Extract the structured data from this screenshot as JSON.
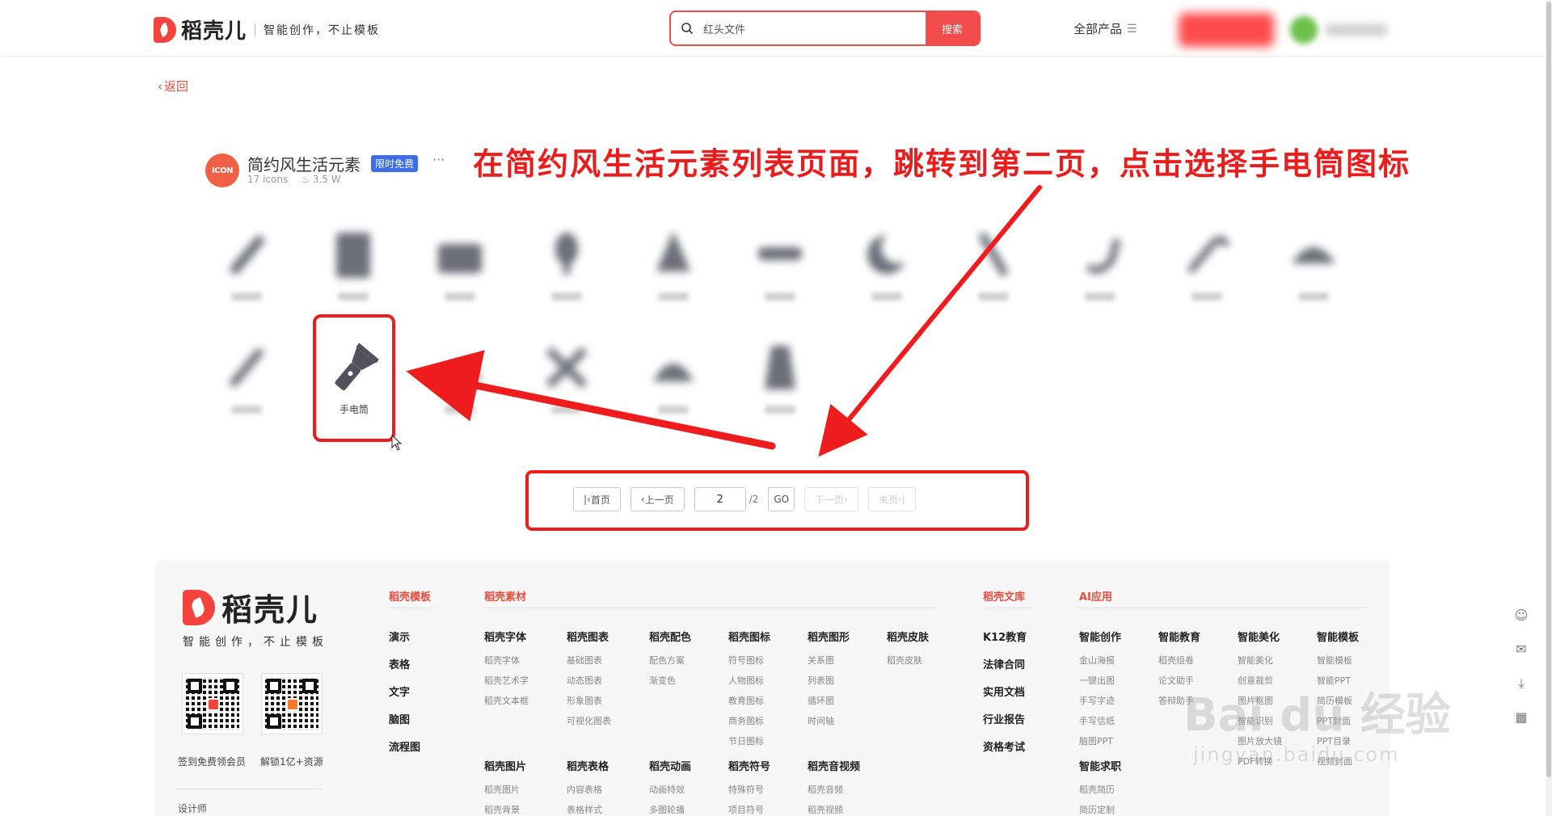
{
  "header": {
    "logo_text": "稻壳儿",
    "slogan": "智能创作，不止模板",
    "search_value": "红头文件",
    "search_button": "搜索",
    "all_products": "全部产品"
  },
  "back_label": "返回",
  "icon_set": {
    "logo_text": "ICON",
    "title": "简约风生活元素",
    "badge": "限时免费",
    "more": "···",
    "count": "17 icons",
    "downloads": "3.5 W"
  },
  "annotation": "在简约风生活元素列表页面，跳转到第二页，点击选择手电筒图标",
  "selected_icon_label": "手电筒",
  "pagination": {
    "first": "首页",
    "prev": "上一页",
    "current": "2",
    "total": "/2",
    "go": "GO",
    "next": "下一页",
    "last": "末页"
  },
  "footer": {
    "logo_text": "稻壳儿",
    "slogan": "智能创作，不止模板",
    "qr1_caption": "签到免费领会员",
    "qr2_caption": "解锁1亿+资源",
    "designer": "设计师",
    "cat_template": "稻壳模板",
    "cat_material": "稻壳素材",
    "cat_library": "稻壳文库",
    "cat_ai": "AI应用",
    "template_items": [
      "演示",
      "表格",
      "文字",
      "脑图",
      "流程图"
    ],
    "material_cols": [
      {
        "h": "稻壳字体",
        "items": [
          "稻壳字体",
          "稻壳艺术字",
          "稻壳文本框"
        ]
      },
      {
        "h": "稻壳图表",
        "items": [
          "基础图表",
          "动态图表",
          "形象图表",
          "可视化图表"
        ]
      },
      {
        "h": "稻壳配色",
        "items": [
          "配色方案",
          "渐变色"
        ]
      },
      {
        "h": "稻壳图标",
        "items": [
          "符号图标",
          "人物图标",
          "教育图标",
          "商务图标",
          "节日图标"
        ]
      },
      {
        "h": "稻壳图形",
        "items": [
          "关系图",
          "列表图",
          "循环图",
          "时间轴"
        ]
      },
      {
        "h": "稻壳皮肤",
        "items": [
          "稻壳皮肤"
        ]
      }
    ],
    "material_cols2": [
      {
        "h": "稻壳图片",
        "items": [
          "稻壳图片",
          "稻壳背景"
        ]
      },
      {
        "h": "稻壳表格",
        "items": [
          "内容表格",
          "表格样式"
        ]
      },
      {
        "h": "稻壳动画",
        "items": [
          "动画特效",
          "多图轮播"
        ]
      },
      {
        "h": "稻壳符号",
        "items": [
          "特殊符号",
          "项目符号"
        ]
      },
      {
        "h": "稻壳音视频",
        "items": [
          "稻壳音频",
          "稻壳视频"
        ]
      }
    ],
    "library_items": [
      "K12教育",
      "法律合同",
      "实用文档",
      "行业报告",
      "资格考试"
    ],
    "ai_cols": [
      {
        "h": "智能创作",
        "items": [
          "金山海报",
          "一键出图",
          "手写字迹",
          "手写信纸",
          "脑图PPT"
        ]
      },
      {
        "h": "智能教育",
        "items": [
          "稻壳组卷",
          "论文助手",
          "答辩助手"
        ]
      },
      {
        "h": "智能美化",
        "items": [
          "智能美化",
          "创意裁剪",
          "图片抠图",
          "智能识别",
          "图片放大镜",
          "PDF转换"
        ]
      },
      {
        "h": "智能模板",
        "items": [
          "智能模板",
          "智能PPT",
          "简历模板",
          "PPT封面",
          "PPT目录",
          "视频封面"
        ]
      }
    ],
    "ai_cols2": [
      {
        "h": "智能求职",
        "items": [
          "稻壳简历",
          "简历定制"
        ]
      }
    ]
  },
  "watermark": "Bai du 经验",
  "watermark_sub": "jingyan.baidu.com",
  "colors": {
    "brand": "#f4433c",
    "annotation": "#ee1c1c",
    "badge": "#3f6ce8"
  }
}
